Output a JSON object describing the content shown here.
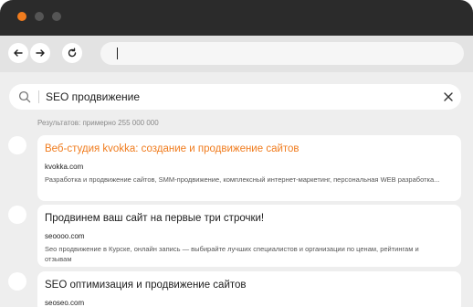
{
  "window": {
    "dots": [
      {
        "name": "close-dot",
        "color": "#f07c1e"
      },
      {
        "name": "minimize-dot",
        "color": "#555555"
      },
      {
        "name": "maximize-dot",
        "color": "#555555"
      }
    ]
  },
  "toolbar": {
    "back_icon": "arrow-left-icon",
    "forward_icon": "arrow-right-icon",
    "reload_icon": "reload-icon",
    "address_value": ""
  },
  "search": {
    "query": "SEO продвижение",
    "results_count": "Результатов: примерно 255 000 000"
  },
  "results": [
    {
      "title": "Веб-студия kvokka: создание и продвижение сайтов",
      "url": "kvokka.com",
      "description": "Разработка и продвижение сайтов, SMM-продвижение, комплексный интернет-маркетинг, персональная WEB разработка..."
    },
    {
      "title": "Продвинем ваш сайт на первые три строчки!",
      "url": "seoooo.com",
      "description": "Seo продвижение в Курске, онлайн запись — выбирайте лучших специалистов и организации по ценам, рейтингам и отзывам"
    },
    {
      "title": "SEO оптимизация и продвижение сайтов",
      "url": "seoseo.com",
      "description": ""
    }
  ],
  "colors": {
    "accent": "#f07c1e",
    "titlebar": "#2b2b2b",
    "background": "#eeeeee"
  }
}
